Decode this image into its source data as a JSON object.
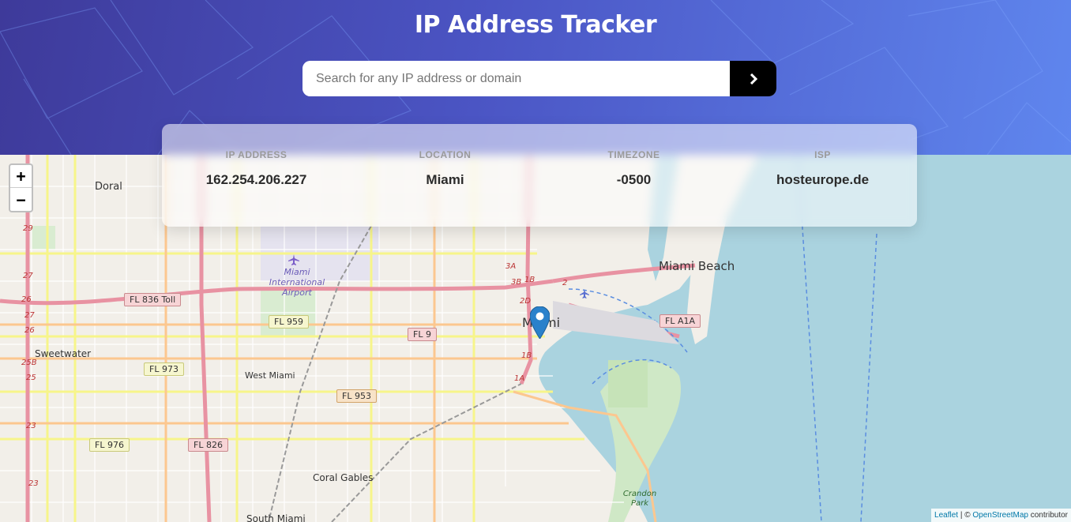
{
  "app": {
    "title": "IP Address Tracker"
  },
  "search": {
    "placeholder": "Search for any IP address or domain",
    "value": "",
    "submit_icon": "chevron-right-icon"
  },
  "info": [
    {
      "label": "IP ADDRESS",
      "value": "162.254.206.227"
    },
    {
      "label": "LOCATION",
      "value": "Miami"
    },
    {
      "label": "TIMEZONE",
      "value": "-0500"
    },
    {
      "label": "ISP",
      "value": "hosteurope.de"
    }
  ],
  "map": {
    "zoom_in": "+",
    "zoom_out": "−",
    "places": {
      "doral": "Doral",
      "miami_international_airport": "Miami International Airport",
      "miami": "Miami",
      "miami_beach": "Miami Beach",
      "sweetwater": "Sweetwater",
      "west_miami": "West Miami",
      "coral_gables": "Coral Gables",
      "south_miami": "South Miami",
      "crandon_park": "Crandon Park"
    },
    "shields": {
      "fl836": "FL 836 Toll",
      "fl959": "FL 959",
      "fl9": "FL 9",
      "fl973": "FL 973",
      "fl953": "FL 953",
      "fl976": "FL 976",
      "fl826": "FL 826",
      "fla1a": "FL A1A"
    },
    "exits": [
      "29",
      "27",
      "26",
      "27",
      "26",
      "25B",
      "25",
      "23",
      "23",
      "3A",
      "3B",
      "1B",
      "2",
      "2D",
      "1B",
      "1A"
    ],
    "marker_icon": "map-pin-icon"
  },
  "attribution": {
    "leaflet": "Leaflet",
    "separator": " | © ",
    "osm": "OpenStreetMap",
    "suffix": " contributor"
  },
  "colors": {
    "header_start": "#3e3a9a",
    "header_end": "#5f86ee",
    "button": "#000000",
    "marker": "#2a81cb",
    "water": "#aad3df"
  }
}
